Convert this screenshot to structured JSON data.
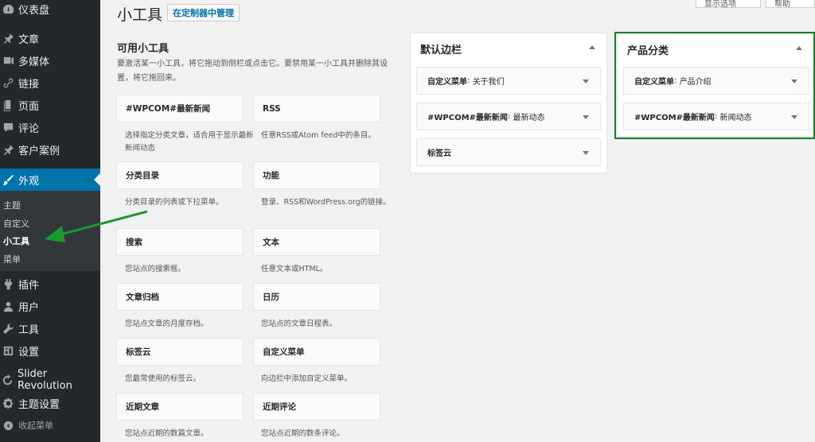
{
  "sidebar": {
    "top_items": [
      {
        "label": "仪表盘",
        "icon": "dashboard-icon"
      },
      {
        "label": "文章",
        "icon": "pin-icon"
      },
      {
        "label": "多媒体",
        "icon": "media-icon"
      },
      {
        "label": "链接",
        "icon": "link-icon"
      },
      {
        "label": "页面",
        "icon": "page-icon"
      },
      {
        "label": "评论",
        "icon": "comment-icon"
      },
      {
        "label": "客户案例",
        "icon": "pin-icon"
      },
      {
        "label": "外观",
        "icon": "brush-icon"
      }
    ],
    "submenu": [
      "主题",
      "自定义",
      "小工具",
      "菜单"
    ],
    "bottom_items": [
      {
        "label": "插件",
        "icon": "plugin-icon"
      },
      {
        "label": "用户",
        "icon": "user-icon"
      },
      {
        "label": "工具",
        "icon": "wrench-icon"
      },
      {
        "label": "设置",
        "icon": "settings-icon"
      },
      {
        "label": "Slider Revolution",
        "icon": "refresh-icon"
      },
      {
        "label": "主题设置",
        "icon": "gear-icon"
      },
      {
        "label": "收起菜单",
        "icon": "collapse-icon"
      }
    ],
    "active_color": "#0073aa"
  },
  "top_buttons": [
    "显示选项",
    "帮助"
  ],
  "page": {
    "title": "小工具",
    "manage_button": "在定制器中管理"
  },
  "available": {
    "title": "可用小工具",
    "description": "要激活某一小工具，将它拖动到侧栏或点击它。要禁用某一小工具并删除其设置，将它拖回来。",
    "widgets": [
      {
        "name": "#WPCOM#最新新闻",
        "desc": "选择指定分类文章，适合用于显示最新新闻动态"
      },
      {
        "name": "RSS",
        "desc": "任意RSS或Atom feed中的条目。"
      },
      {
        "name": "分类目录",
        "desc": "分类目录的列表或下拉菜单。"
      },
      {
        "name": "功能",
        "desc": "登录、RSS和WordPress.org的链接。"
      },
      {
        "name": "搜索",
        "desc": "您站点的搜索框。"
      },
      {
        "name": "文本",
        "desc": "任意文本或HTML。"
      },
      {
        "name": "文章归档",
        "desc": "您站点文章的月度存档。"
      },
      {
        "name": "日历",
        "desc": "您站点的文章日程表。"
      },
      {
        "name": "标签云",
        "desc": "您最常使用的标签云。"
      },
      {
        "name": "自定义菜单",
        "desc": "向边栏中添加自定义菜单。"
      },
      {
        "name": "近期文章",
        "desc": "您站点近期的数篇文章。"
      },
      {
        "name": "近期评论",
        "desc": "您站点近期的数条评论。"
      }
    ]
  },
  "default_sidebar": {
    "title": "默认边栏",
    "widgets": [
      {
        "type": "自定义菜单",
        "title": "关于我们"
      },
      {
        "type": "#WPCOM#最新新闻",
        "title": "最新动态"
      },
      {
        "type": "标签云",
        "title": ""
      }
    ]
  },
  "product_sidebar": {
    "title": "产品分类",
    "widgets": [
      {
        "type": "自定义菜单",
        "title": "产品介绍"
      },
      {
        "type": "#WPCOM#最新新闻",
        "title": "新闻动态"
      }
    ],
    "highlight_color": "#1a7a2a"
  }
}
